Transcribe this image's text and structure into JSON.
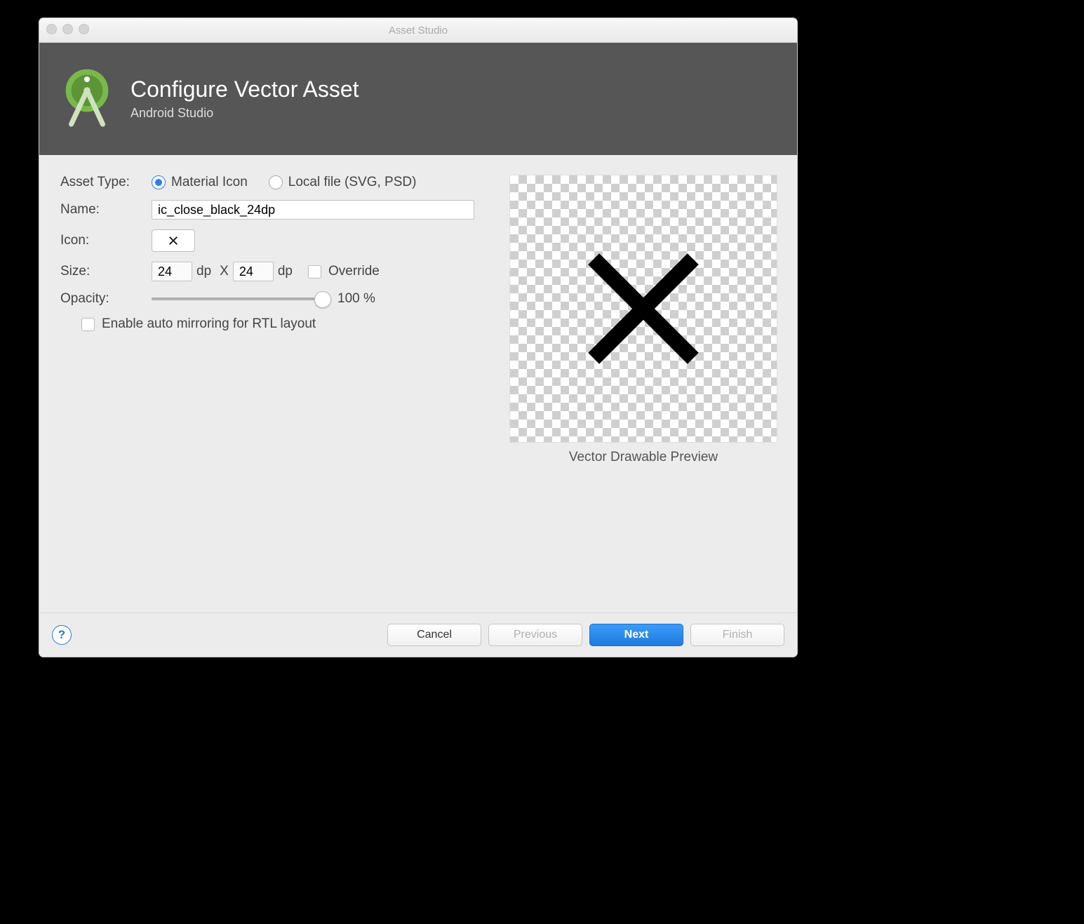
{
  "window": {
    "title": "Asset Studio"
  },
  "banner": {
    "title": "Configure Vector Asset",
    "subtitle": "Android Studio"
  },
  "form": {
    "assetTypeLabel": "Asset Type:",
    "radioMaterial": "Material Icon",
    "radioLocal": "Local file (SVG, PSD)",
    "nameLabel": "Name:",
    "nameValue": "ic_close_black_24dp",
    "iconLabel": "Icon:",
    "sizeLabel": "Size:",
    "sizeW": "24",
    "sizeH": "24",
    "dp": "dp",
    "x": "X",
    "overrideLabel": "Override",
    "opacityLabel": "Opacity:",
    "opacityValue": "100 %",
    "rtlLabel": "Enable auto mirroring for RTL layout"
  },
  "preview": {
    "label": "Vector Drawable Preview"
  },
  "footer": {
    "cancel": "Cancel",
    "previous": "Previous",
    "next": "Next",
    "finish": "Finish"
  }
}
